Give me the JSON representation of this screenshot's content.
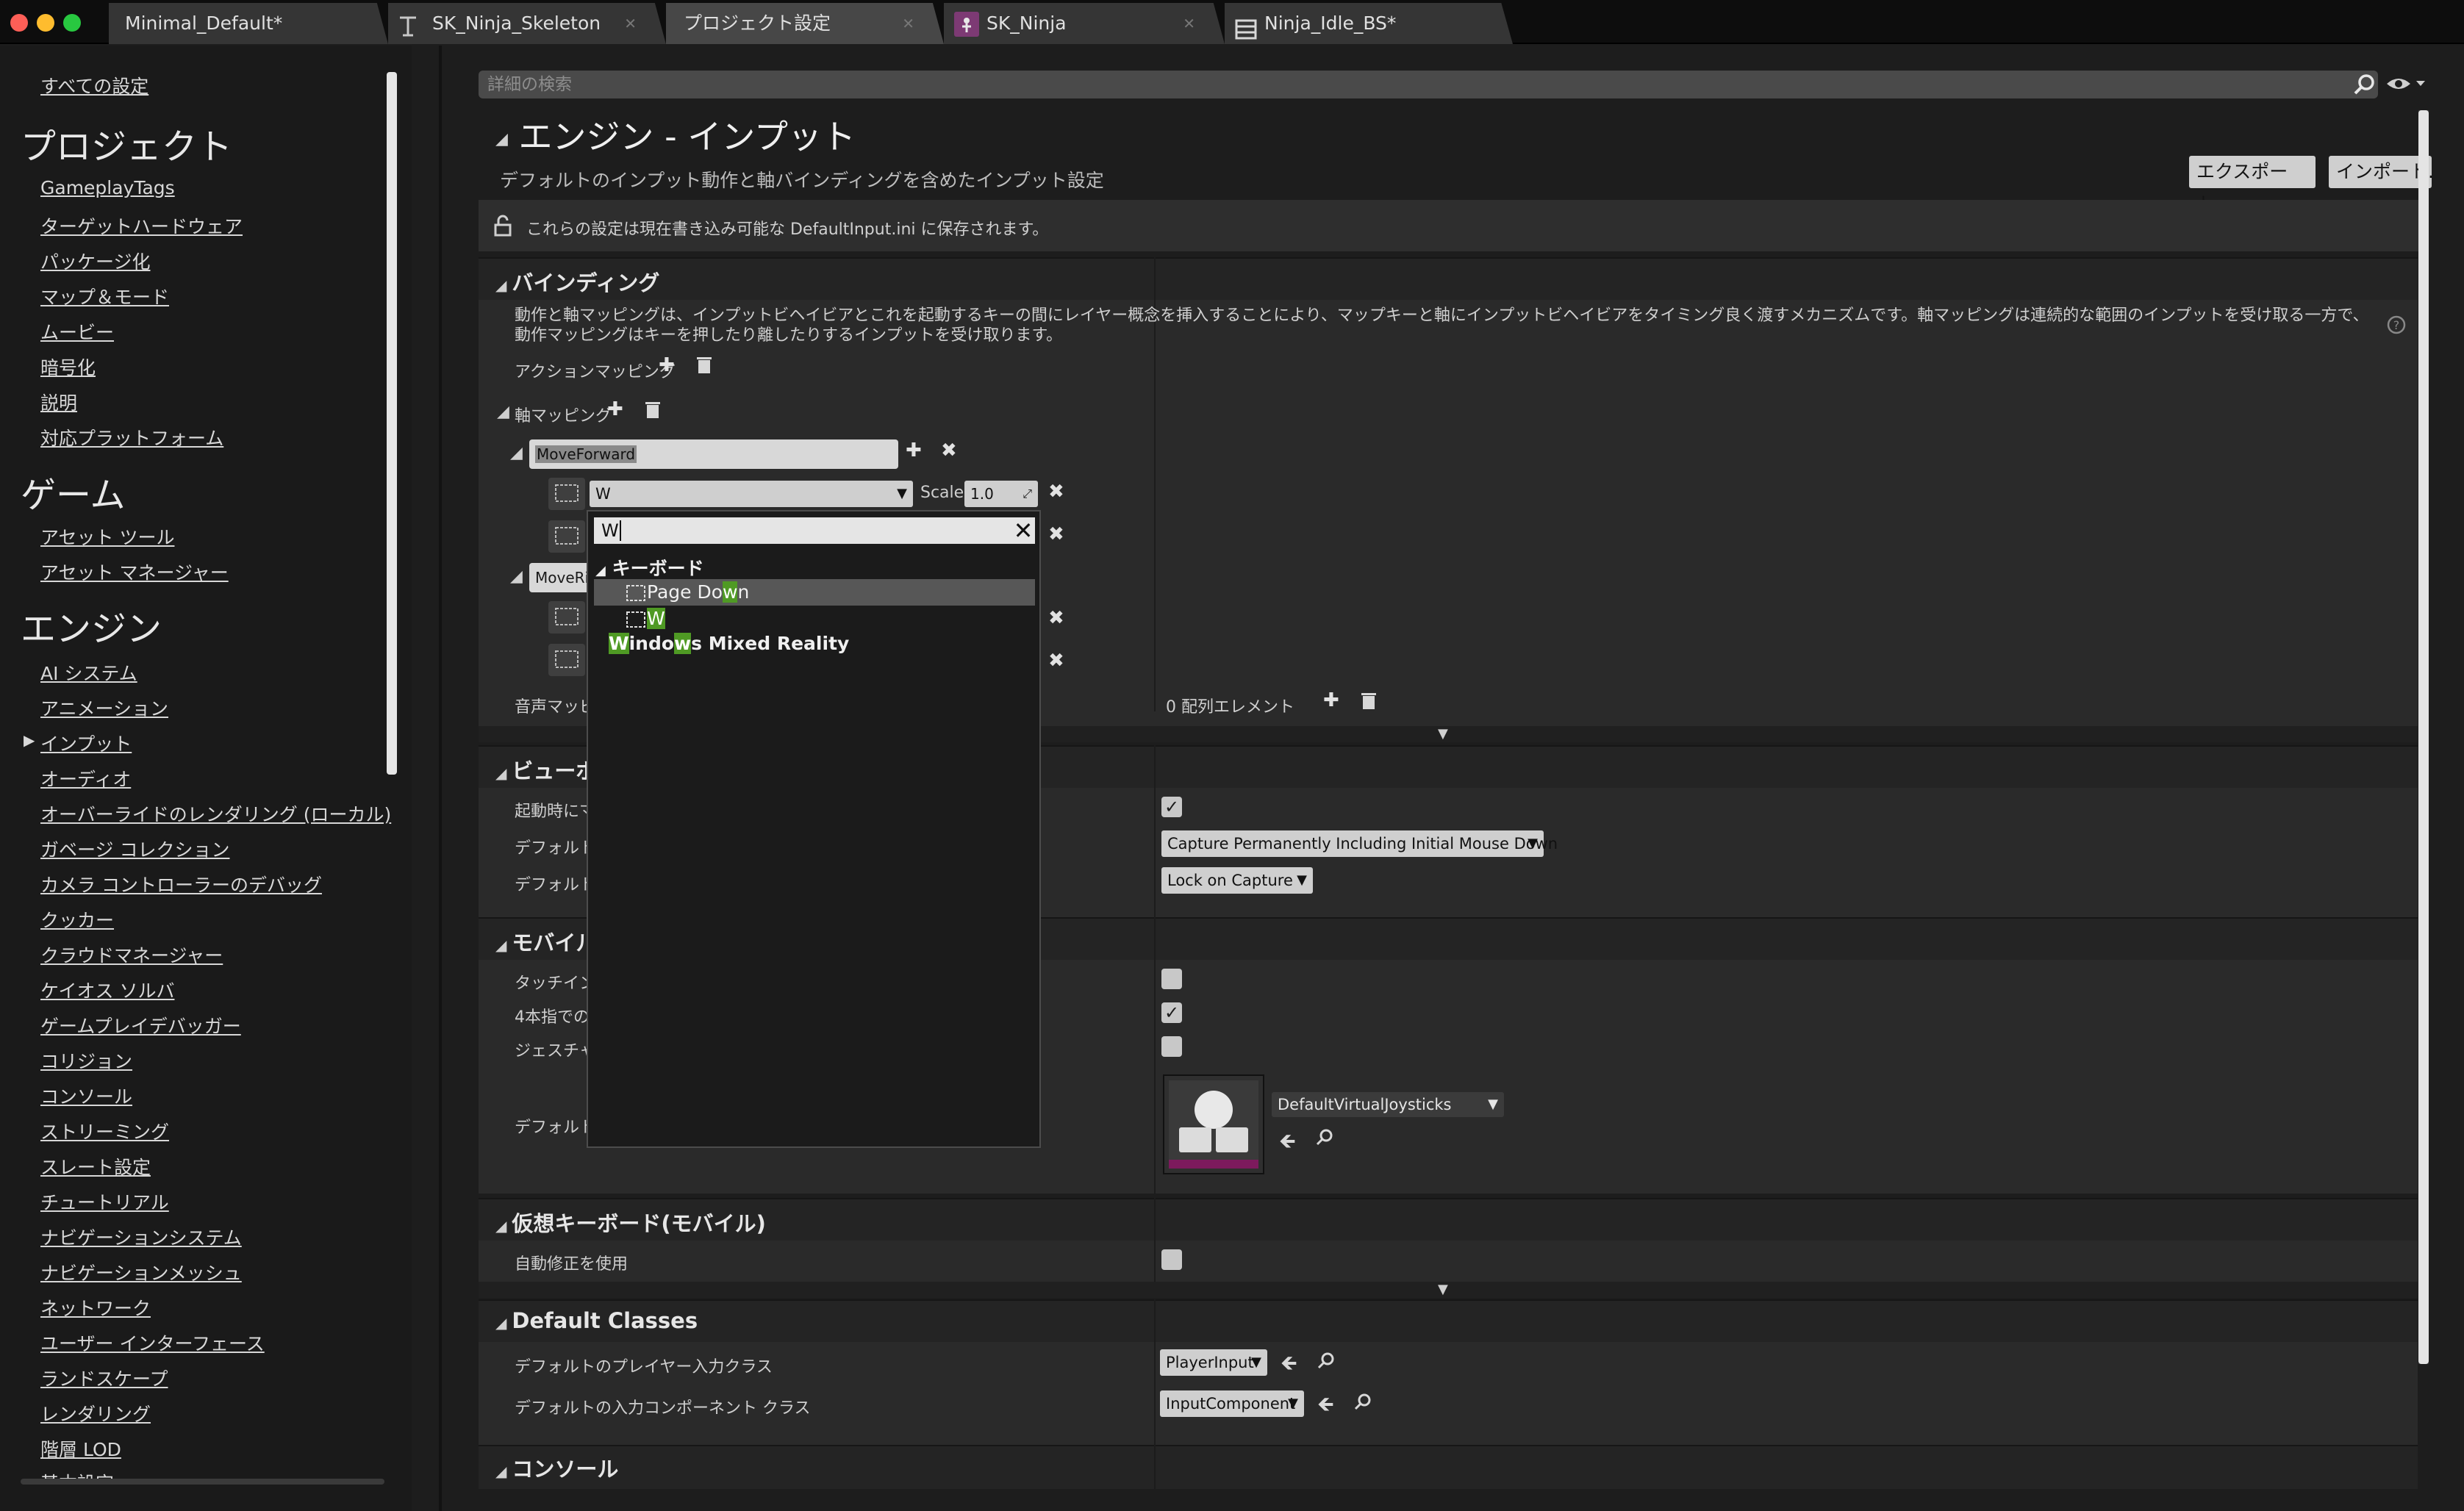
{
  "window": {
    "tabs": [
      {
        "label": "Minimal_Default*"
      },
      {
        "label": "SK_Ninja_Skeleton"
      },
      {
        "label": "プロジェクト設定"
      },
      {
        "label": "SK_Ninja"
      },
      {
        "label": "Ninja_Idle_BS*"
      }
    ],
    "traffic_colors": [
      "#fe5f57",
      "#febc2e",
      "#28c840"
    ]
  },
  "sidebar": {
    "all_settings": "すべての設定",
    "sections": [
      {
        "title": "プロジェクト",
        "items": [
          "GameplayTags",
          "ターゲットハードウェア",
          "パッケージ化",
          "マップ＆モード",
          "ムービー",
          "暗号化",
          "説明",
          "対応プラットフォーム"
        ]
      },
      {
        "title": "ゲーム",
        "items": [
          "アセット ツール",
          "アセット マネージャー"
        ]
      },
      {
        "title": "エンジン",
        "items": [
          "AI システム",
          "アニメーション",
          "インプット",
          "オーディオ",
          "オーバーライドのレンダリング (ローカル)",
          "ガベージ コレクション",
          "カメラ コントローラーのデバッグ",
          "クッカー",
          "クラウドマネージャー",
          "ケイオス ソルバ",
          "ゲームプレイデバッガー",
          "コリジョン",
          "コンソール",
          "ストリーミング",
          "スレート設定",
          "チュートリアル",
          "ナビゲーションシステム",
          "ナビゲーションメッシュ",
          "ネットワーク",
          "ユーザー インターフェース",
          "ランドスケープ",
          "レンダリング",
          "階層 LOD",
          "基本設定"
        ]
      }
    ],
    "selected": "インプット"
  },
  "search": {
    "placeholder": "詳細の検索"
  },
  "header": {
    "title": "エンジン - インプット",
    "subtitle": "デフォルトのインプット動作と軸バインディングを含めたインプット設定",
    "export": "エクスポート...",
    "import": "インポート..."
  },
  "notice": "これらの設定は現在書き込み可能な DefaultInput.ini に保存されます。",
  "bindings": {
    "title": "バインディング",
    "desc": "動作と軸マッピングは、インプットビヘイビアとこれを起動するキーの間にレイヤー概念を挿入することにより、マップキーと軸にインプットビヘイビアをタイミング良く渡すメカニズムです。軸マッピングは連続的な範囲のインプットを受け取る一方で、動作マッピングはキーを押したり離したりするインプットを受け取ります。",
    "action_mappings": "アクションマッピング",
    "axis_mappings": "軸マッピング",
    "axis1_name": "MoveForward",
    "axis1_key": "W",
    "scale_label": "Scale",
    "scale_value": "1.0",
    "axis2_name": "MoveRi",
    "speech_label": "音声マッピ",
    "speech_value": "0 配列エレメント"
  },
  "viewport": {
    "title": "ビューポ",
    "rows": [
      {
        "label": "起動時にマ",
        "checked": true
      },
      {
        "label": "デフォルトの",
        "value": "Capture Permanently Including Initial Mouse Down"
      },
      {
        "label": "デフォルトの",
        "value": "Lock on Capture"
      }
    ]
  },
  "mobile": {
    "title": "モバイル",
    "rows": [
      {
        "label": "タッチイン",
        "checked": false
      },
      {
        "label": "4本指での",
        "checked": true
      },
      {
        "label": "ジェスチャ",
        "checked": false
      },
      {
        "label": "デフォルトの",
        "value": "DefaultVirtualJoysticks"
      }
    ]
  },
  "virtual_keyboard": {
    "title": "仮想キーボード(モバイル)",
    "autocorrect": "自動修正を使用",
    "autocorrect_checked": false
  },
  "default_classes": {
    "title": "Default Classes",
    "rows": [
      {
        "label": "デフォルトのプレイヤー入力クラス",
        "value": "PlayerInput"
      },
      {
        "label": "デフォルトの入力コンポーネント クラス",
        "value": "InputComponent"
      }
    ]
  },
  "console": {
    "title": "コンソール"
  },
  "popup": {
    "filter_value": "W",
    "category": "キーボード",
    "items": [
      {
        "pre": "Page Do",
        "hl": "w",
        "post": "n",
        "selected": true
      },
      {
        "pre": "",
        "hl": "W",
        "post": ""
      }
    ],
    "extra": {
      "hl1": "W",
      "mid1": "indo",
      "hl2": "w",
      "post": "s Mixed Reality"
    }
  },
  "colors": {
    "accent_green": "#4f9a24",
    "thumbnail_magenta": "#7d1a5d"
  }
}
